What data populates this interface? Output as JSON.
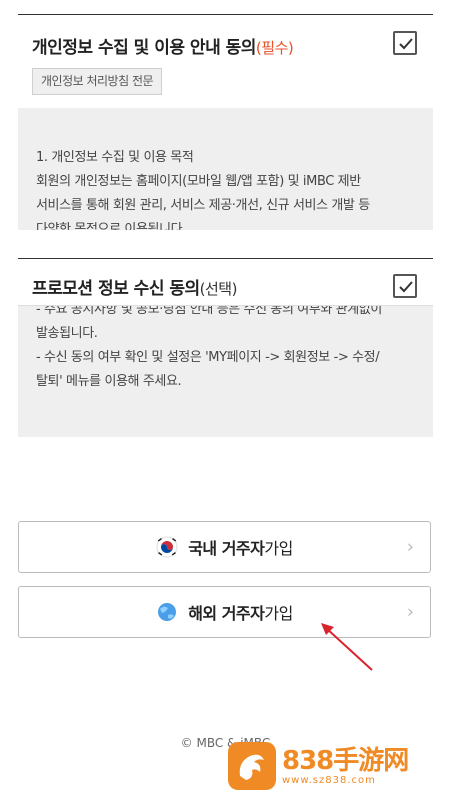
{
  "consent_privacy": {
    "title": "개인정보 수집 및 이용 안내 동의",
    "tag": "(필수)",
    "checked": true,
    "policy_button": "개인정보 처리방침 전문",
    "terms_lines": [
      "1. 개인정보 수집 및 이용 목적",
      "회원의 개인정보는 홈페이지(모바일 웹/앱 포함) 및 iMBC 제반",
      "서비스를 통해 회원 관리, 서비스 제공·개선, 신규 서비스 개발 등",
      "다양한 목적으로 이용됩니다."
    ]
  },
  "consent_promo": {
    "title": "프로모션 정보 수신 동의",
    "tag": "(선택)",
    "checked": true,
    "terms_lines": [
      "- 주요 공지사항 및 공모·당첨 안내 등은 수신 동의 여부와 관계없이",
      "발송됩니다.",
      "- 수신 동의 여부 확인 및 설정은 'MY페이지 -> 회원정보 -> 수정/",
      "탈퇴' 메뉴를 이용해 주세요."
    ]
  },
  "join": {
    "domestic_bold": "국내 거주자",
    "domestic_rest": "가입",
    "overseas_bold": "해외 거주자",
    "overseas_rest": "가입",
    "chevron": "›"
  },
  "footer": {
    "copyright": "© MBC & iMBC"
  },
  "watermark": {
    "main": "838手游网",
    "url": "www.sz838.com"
  },
  "colors": {
    "required": "#e8502b",
    "watermark": "#f08a24",
    "annotation_arrow": "#d9232d"
  }
}
